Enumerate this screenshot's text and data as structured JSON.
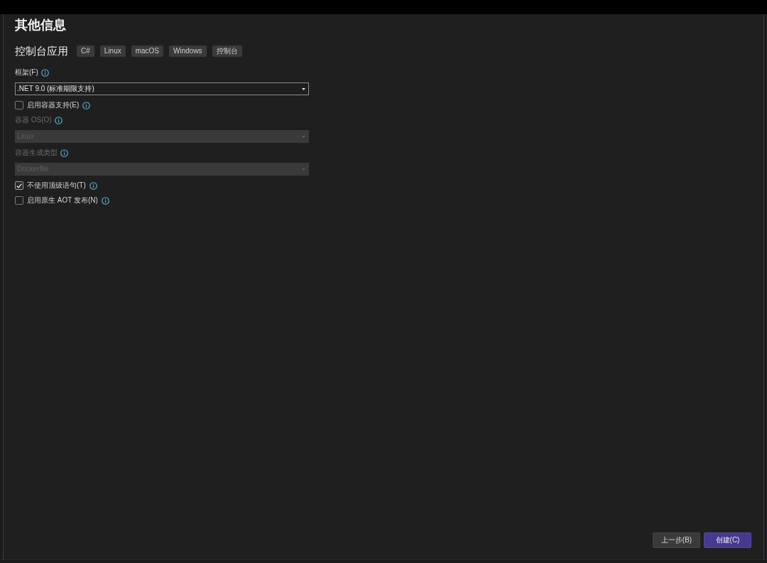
{
  "title": "其他信息",
  "project": {
    "name": "控制台应用",
    "tags": [
      "C#",
      "Linux",
      "macOS",
      "Windows",
      "控制台"
    ]
  },
  "fields": [
    {
      "kind": "dropdown",
      "label": "框架(F)",
      "value": ".NET 9.0 (标准期限支持)",
      "disabled": false
    },
    {
      "kind": "checkbox",
      "label": "启用容器支持(E)",
      "checked": false
    },
    {
      "kind": "dropdown",
      "label": "容器 OS(O)",
      "value": "Linux",
      "disabled": true
    },
    {
      "kind": "dropdown",
      "label": "容器生成类型",
      "value": "Dockerfile",
      "disabled": true
    },
    {
      "kind": "checkbox",
      "label": "不使用顶级语句(T)",
      "checked": true
    },
    {
      "kind": "checkbox",
      "label": "启用原生 AOT 发布(N)",
      "checked": false
    }
  ],
  "buttons": [
    {
      "kind": "secondary",
      "label": "上一步(B)"
    },
    {
      "kind": "primary",
      "label": "创建(C)"
    }
  ]
}
